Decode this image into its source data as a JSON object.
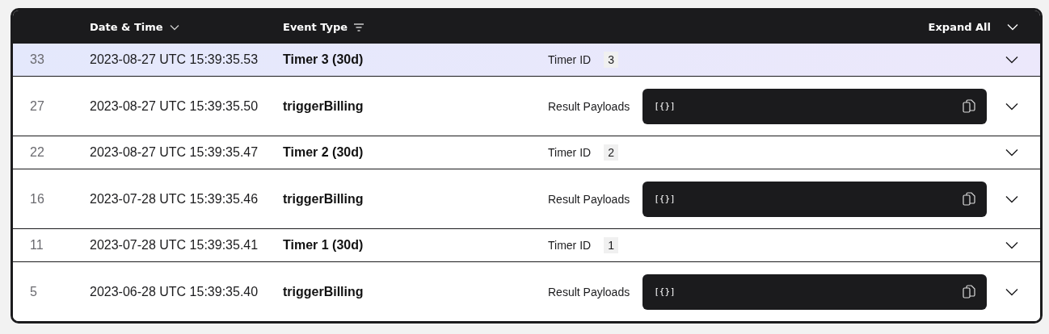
{
  "header": {
    "columns": [
      {
        "label": "Date & Time",
        "kind": "sort"
      },
      {
        "label": "Event Type",
        "kind": "filter"
      }
    ],
    "expand_all": "Expand All"
  },
  "rows": [
    {
      "id": "33",
      "datetime": "2023-08-27 UTC 15:39:35.53",
      "event": "Timer 3 (30d)",
      "kind": "timer",
      "label": "Timer ID",
      "value": "3",
      "selected": true
    },
    {
      "id": "27",
      "datetime": "2023-08-27 UTC 15:39:35.50",
      "event": "triggerBilling",
      "kind": "payload",
      "label": "Result Payloads",
      "value": "[{}]",
      "selected": false
    },
    {
      "id": "22",
      "datetime": "2023-08-27 UTC 15:39:35.47",
      "event": "Timer 2 (30d)",
      "kind": "timer",
      "label": "Timer ID",
      "value": "2",
      "selected": false
    },
    {
      "id": "16",
      "datetime": "2023-07-28 UTC 15:39:35.46",
      "event": "triggerBilling",
      "kind": "payload",
      "label": "Result Payloads",
      "value": "[{}]",
      "selected": false
    },
    {
      "id": "11",
      "datetime": "2023-07-28 UTC 15:39:35.41",
      "event": "Timer 1 (30d)",
      "kind": "timer",
      "label": "Timer ID",
      "value": "1",
      "selected": false
    },
    {
      "id": "5",
      "datetime": "2023-06-28 UTC 15:39:35.40",
      "event": "triggerBilling",
      "kind": "payload",
      "label": "Result Payloads",
      "value": "[{}]",
      "selected": false
    }
  ]
}
